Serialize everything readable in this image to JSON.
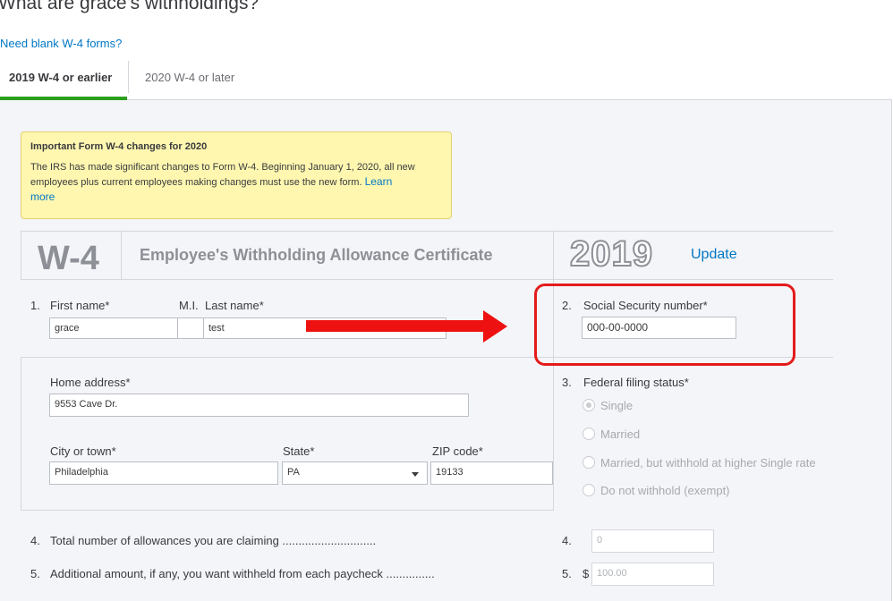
{
  "page_title": "What are grace's withholdings?",
  "blank_forms_link": "Need blank W-4 forms?",
  "tabs": [
    {
      "label": "2019 W-4 or earlier"
    },
    {
      "label": "2020 W-4 or later"
    }
  ],
  "notice": {
    "title": "Important Form W-4 changes for 2020",
    "body": "The IRS has made significant changes to Form W-4. Beginning January 1, 2020, all new employees plus current employees making changes must use the new form.",
    "link": "Learn more"
  },
  "form_header": {
    "w4": "W-4",
    "certificate_title": "Employee's Withholding Allowance Certificate",
    "year": "2019",
    "update_link": "Update"
  },
  "fields": {
    "n1": "1.",
    "first_name_label": "First name*",
    "first_name_value": "grace",
    "mi_label": "M.I.",
    "mi_value": "",
    "last_name_label": "Last name*",
    "last_name_value": "test",
    "n2": "2.",
    "ssn_label": "Social Security number*",
    "ssn_value": "000-00-0000",
    "home_address_label": "Home address*",
    "home_address_value": "9553 Cave Dr.",
    "city_label": "City or town*",
    "city_value": "Philadelphia",
    "state_label": "State*",
    "state_value": "PA",
    "zip_label": "ZIP code*",
    "zip_value": "19133",
    "n3": "3.",
    "filing_status_label": "Federal filing status*",
    "filing_options": [
      "Single",
      "Married",
      "Married, but withhold at higher Single rate",
      "Do not withhold (exempt)"
    ],
    "filing_selected": "Single",
    "n4": "4.",
    "allowances_label": "Total number of allowances you are claiming .............................",
    "allowances_num": "4.",
    "allowances_value": "0",
    "n5": "5.",
    "additional_label": "Additional amount, if any, you want withheld from each paycheck ...............",
    "additional_num": "5.",
    "currency": "$",
    "additional_value": "100.00"
  },
  "colors": {
    "accent_green": "#2ca01c",
    "link_blue": "#0077c5",
    "annotation_red": "#e41b1b",
    "notice_bg": "#fff7b0"
  }
}
